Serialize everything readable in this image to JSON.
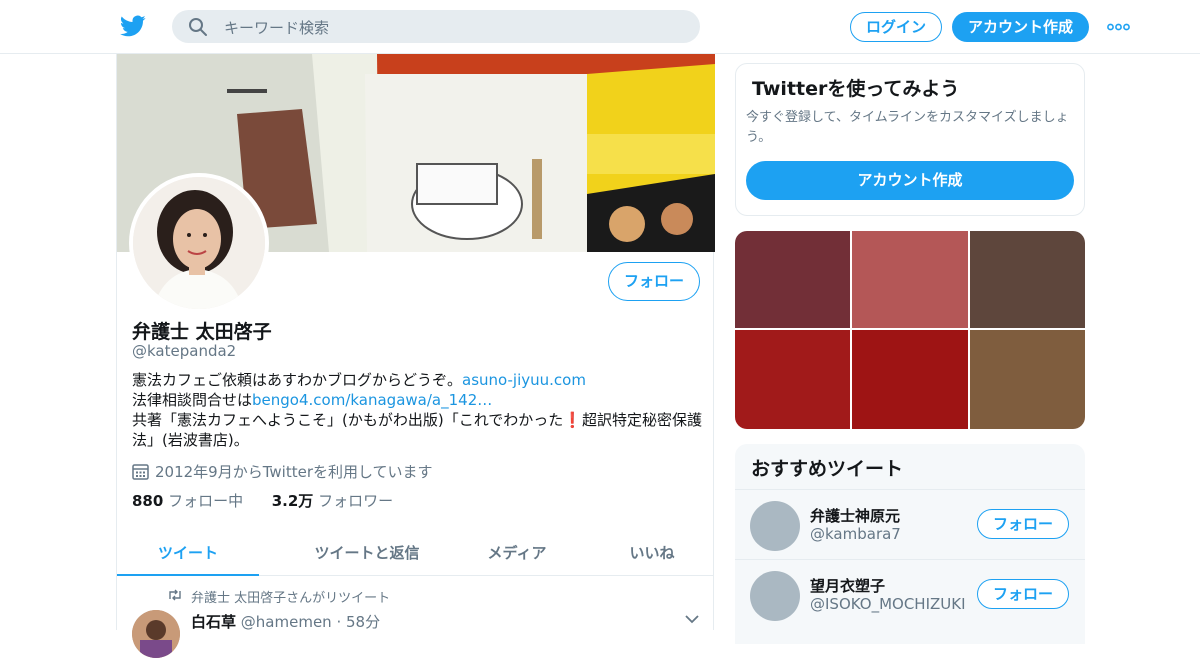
{
  "header": {
    "search_placeholder": "キーワード検索",
    "login_label": "ログイン",
    "signup_label": "アカウント作成"
  },
  "colors": {
    "accent": "#1da1f2",
    "link": "#1b95e0",
    "text_secondary": "#657786"
  },
  "icons": {
    "logo": "twitter-bird-icon",
    "search": "search-icon",
    "more": "more-dots-icon",
    "calendar": "calendar-icon",
    "retweet": "retweet-icon",
    "caret": "chevron-down-icon"
  },
  "profile": {
    "follow_label": "フォロー",
    "name": "弁護士 太田啓子",
    "handle": "@katepanda2",
    "bio_line1_text": "憲法カフェご依頼はあすわかブログからどうぞ。",
    "bio_line1_link": "asuno-jiyuu.com",
    "bio_line2_text": "法律相談問合せは",
    "bio_line2_link": "bengo4.com/kanagawa/a_142…",
    "bio_line3_a": "共著「憲法カフェへようこそ」(かもがわ出版)「これでわかった",
    "bio_line3_mark": "❗",
    "bio_line3_b": "超訳特定秘密保護法」(岩波書店)。",
    "joined": "2012年9月からTwitterを利用しています",
    "following_count": "880",
    "following_label": "フォロー中",
    "followers_count": "3.2万",
    "followers_label": "フォロワー"
  },
  "tabs": [
    {
      "label": "ツイート"
    },
    {
      "label": "ツイートと返信"
    },
    {
      "label": "メディア"
    },
    {
      "label": "いいね"
    }
  ],
  "tweet": {
    "retweet_context": "弁護士 太田啓子さんがリツイート",
    "author_name": "白石草",
    "author_handle": "@hamemen",
    "time": "· 58分"
  },
  "sidebar": {
    "signup_card": {
      "title": "Twitterを使ってみよう",
      "desc": "今すぐ登録して、タイムラインをカスタマイズしましょう。",
      "button": "アカウント作成"
    },
    "media_colors": [
      "#722f37",
      "#b45757",
      "#5e463c",
      "#a11a1a",
      "#9e1414",
      "#7f5d3e"
    ],
    "recommend": {
      "title": "おすすめツイート",
      "users": [
        {
          "name": "弁護士神原元",
          "handle": "@kambara7",
          "button": "フォロー"
        },
        {
          "name": "望月衣塑子",
          "handle": "@ISOKO_MOCHIZUKI",
          "button": "フォロー"
        }
      ]
    }
  }
}
